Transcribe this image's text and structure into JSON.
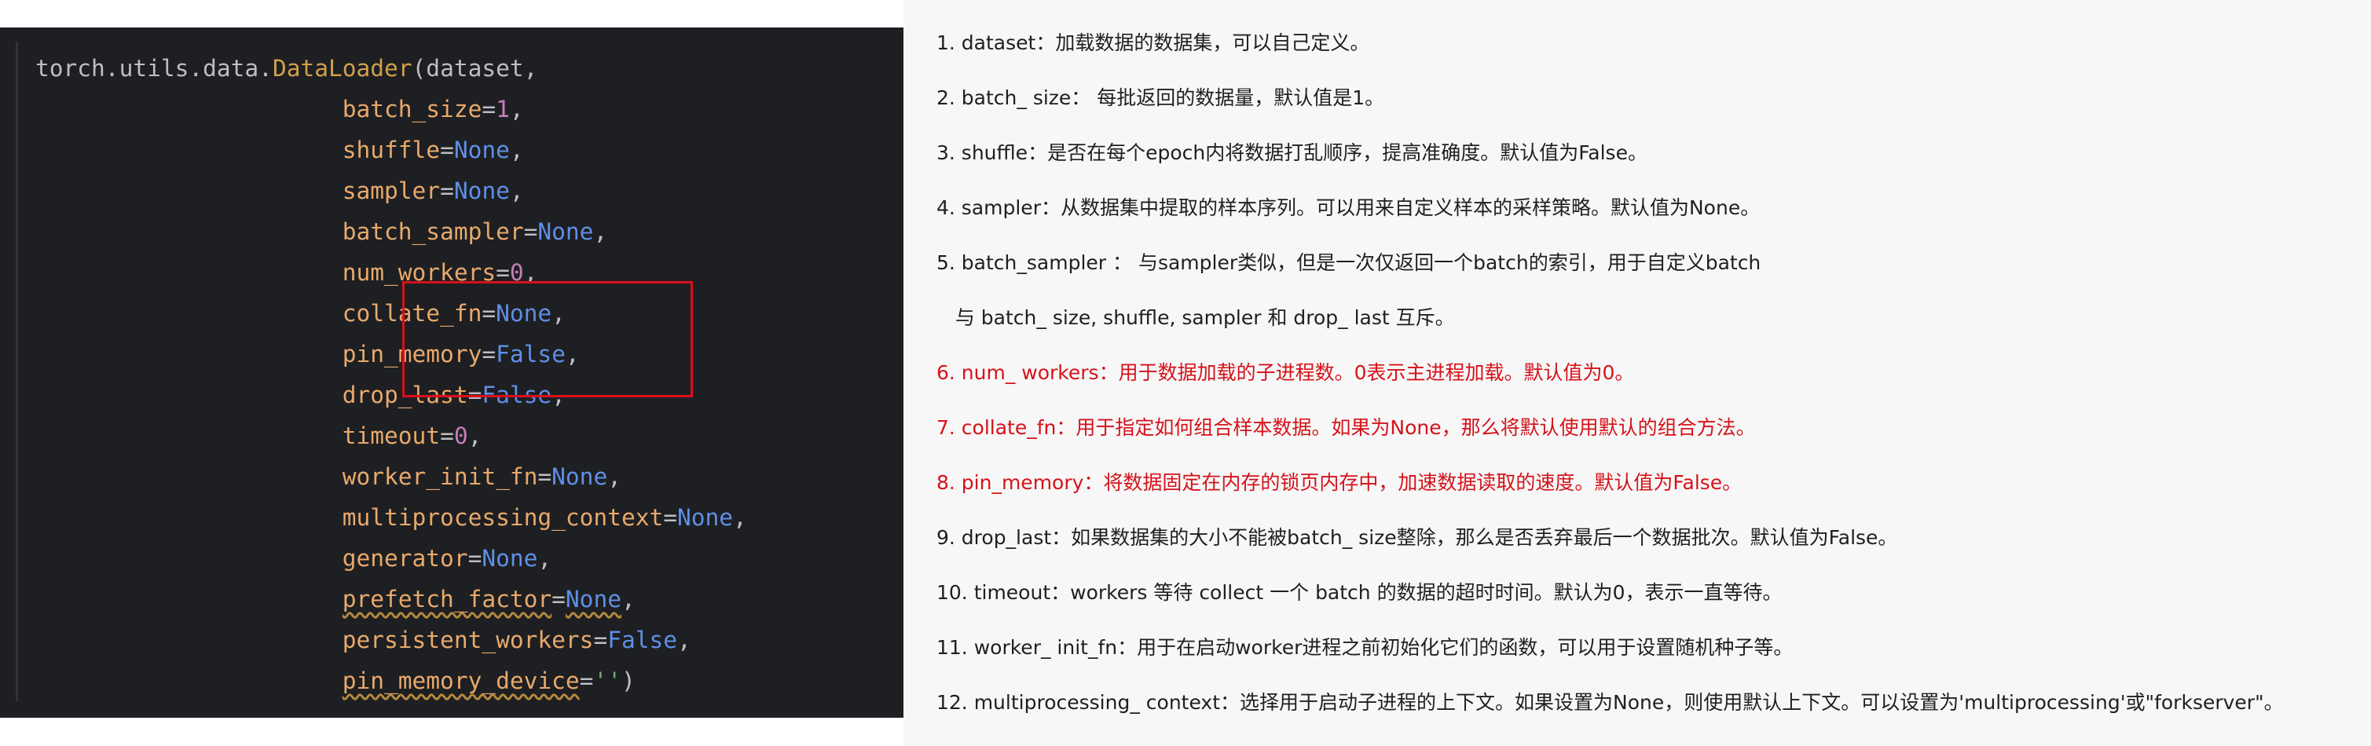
{
  "code": {
    "lines": [
      {
        "indent": "",
        "parts": [
          {
            "t": "torch.utils.data.",
            "c": "pun"
          },
          {
            "t": "DataLoader",
            "c": "kw-fn"
          },
          {
            "t": "(dataset,",
            "c": "pun"
          }
        ]
      },
      {
        "indent": "                      ",
        "parts": [
          {
            "t": "batch_size",
            "c": "kw-param"
          },
          {
            "t": "=",
            "c": "pun"
          },
          {
            "t": "1",
            "c": "num"
          },
          {
            "t": ",",
            "c": "pun"
          }
        ]
      },
      {
        "indent": "                      ",
        "parts": [
          {
            "t": "shuffle",
            "c": "kw-param"
          },
          {
            "t": "=",
            "c": "pun"
          },
          {
            "t": "None",
            "c": "const"
          },
          {
            "t": ",",
            "c": "pun"
          }
        ]
      },
      {
        "indent": "                      ",
        "parts": [
          {
            "t": "sampler",
            "c": "kw-param"
          },
          {
            "t": "=",
            "c": "pun"
          },
          {
            "t": "None",
            "c": "const"
          },
          {
            "t": ",",
            "c": "pun"
          }
        ]
      },
      {
        "indent": "                      ",
        "parts": [
          {
            "t": "batch_sampler",
            "c": "kw-param"
          },
          {
            "t": "=",
            "c": "pun"
          },
          {
            "t": "None",
            "c": "const"
          },
          {
            "t": ",",
            "c": "pun"
          }
        ]
      },
      {
        "indent": "                      ",
        "parts": [
          {
            "t": "num_workers",
            "c": "kw-param"
          },
          {
            "t": "=",
            "c": "pun"
          },
          {
            "t": "0",
            "c": "num"
          },
          {
            "t": ",",
            "c": "pun"
          }
        ]
      },
      {
        "indent": "                      ",
        "parts": [
          {
            "t": "collate_fn",
            "c": "kw-param"
          },
          {
            "t": "=",
            "c": "pun"
          },
          {
            "t": "None",
            "c": "const"
          },
          {
            "t": ",",
            "c": "pun"
          }
        ]
      },
      {
        "indent": "                      ",
        "parts": [
          {
            "t": "pin_memory",
            "c": "kw-param"
          },
          {
            "t": "=",
            "c": "pun"
          },
          {
            "t": "False",
            "c": "const"
          },
          {
            "t": ",",
            "c": "pun"
          }
        ]
      },
      {
        "indent": "                      ",
        "parts": [
          {
            "t": "drop_last",
            "c": "kw-param"
          },
          {
            "t": "=",
            "c": "pun"
          },
          {
            "t": "False",
            "c": "const"
          },
          {
            "t": ",",
            "c": "pun"
          }
        ]
      },
      {
        "indent": "                      ",
        "parts": [
          {
            "t": "timeout",
            "c": "kw-param"
          },
          {
            "t": "=",
            "c": "pun"
          },
          {
            "t": "0",
            "c": "num"
          },
          {
            "t": ",",
            "c": "pun"
          }
        ]
      },
      {
        "indent": "                      ",
        "parts": [
          {
            "t": "worker_init_fn",
            "c": "kw-param"
          },
          {
            "t": "=",
            "c": "pun"
          },
          {
            "t": "None",
            "c": "const"
          },
          {
            "t": ",",
            "c": "pun"
          }
        ]
      },
      {
        "indent": "                      ",
        "parts": [
          {
            "t": "multiprocessing_context",
            "c": "kw-param"
          },
          {
            "t": "=",
            "c": "pun"
          },
          {
            "t": "None",
            "c": "const"
          },
          {
            "t": ",",
            "c": "pun"
          }
        ]
      },
      {
        "indent": "                      ",
        "parts": [
          {
            "t": "generator",
            "c": "kw-param"
          },
          {
            "t": "=",
            "c": "pun"
          },
          {
            "t": "None",
            "c": "const"
          },
          {
            "t": ",",
            "c": "pun"
          }
        ]
      },
      {
        "indent": "                      ",
        "parts": [
          {
            "t": "prefetch_factor",
            "c": "kw-param squiggle"
          },
          {
            "t": "=",
            "c": "pun"
          },
          {
            "t": "None",
            "c": "const squiggle"
          },
          {
            "t": ",",
            "c": "pun"
          }
        ]
      },
      {
        "indent": "                      ",
        "parts": [
          {
            "t": "persistent_workers",
            "c": "kw-param"
          },
          {
            "t": "=",
            "c": "pun"
          },
          {
            "t": "False",
            "c": "const"
          },
          {
            "t": ",",
            "c": "pun"
          }
        ]
      },
      {
        "indent": "                      ",
        "parts": [
          {
            "t": "pin_memory_device",
            "c": "kw-param squiggle"
          },
          {
            "t": "=",
            "c": "pun"
          },
          {
            "t": "''",
            "c": "str"
          },
          {
            "t": ")",
            "c": "pun"
          }
        ]
      }
    ]
  },
  "docs": {
    "items": [
      {
        "text": "1. dataset：加载数据的数据集，可以自己定义。",
        "red": false
      },
      {
        "text": "2. batch_ size： 每批返回的数据量，默认值是1。",
        "red": false
      },
      {
        "text": "3. shuffle：是否在每个epoch内将数据打乱顺序，提高准确度。默认值为False。",
        "red": false
      },
      {
        "text": "4. sampler：从数据集中提取的样本序列。可以用来自定义样本的采样策略。默认值为None。",
        "red": false
      },
      {
        "text": "5. batch_sampler ： 与sampler类似，但是一次仅返回一个batch的索引，用于自定义batch",
        "red": false
      },
      {
        "text": "   与 batch_ size, shuffle, sampler 和 drop_ last 互斥。",
        "red": false
      },
      {
        "text": "6. num_ workers：用于数据加载的子进程数。0表示主进程加载。默认值为0。",
        "red": true
      },
      {
        "text": "7. collate_fn：用于指定如何组合样本数据。如果为None，那么将默认使用默认的组合方法。",
        "red": true
      },
      {
        "text": "8. pin_memory：将数据固定在内存的锁页内存中，加速数据读取的速度。默认值为False。",
        "red": true
      },
      {
        "text": "9. drop_last：如果数据集的大小不能被batch_ size整除，那么是否丢弃最后一个数据批次。默认值为False。",
        "red": false
      },
      {
        "text": "10. timeout：workers 等待 collect 一个 batch 的数据的超时时间。默认为0，表示一直等待。",
        "red": false
      },
      {
        "text": "11. worker_ init_fn：用于在启动worker进程之前初始化它们的函数，可以用于设置随机种子等。",
        "red": false
      },
      {
        "text": "12. multiprocessing_ context：选择用于启动子进程的上下文。如果设置为None，则使用默认上下文。可以设置为'multiprocessing'或\"forkserver\"。",
        "red": false
      }
    ]
  },
  "colors": {
    "editor_bg": "#1e1f22",
    "param": "#e8a96b",
    "number": "#c77dbb",
    "constant": "#5f8fe6",
    "highlight_box": "#d8111b",
    "red_text": "#d6121a"
  }
}
